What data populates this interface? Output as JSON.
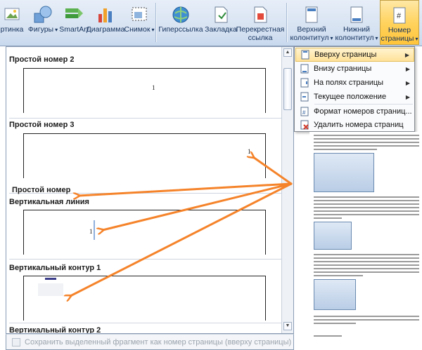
{
  "ribbon": {
    "buttons": [
      {
        "label": "Картинка",
        "icon": "picture-icon"
      },
      {
        "label": "Фигуры",
        "icon": "shapes-icon"
      },
      {
        "label": "SmartArt",
        "icon": "smartart-icon"
      },
      {
        "label": "Диаграмма",
        "icon": "chart-icon"
      },
      {
        "label": "Снимок",
        "icon": "screenshot-icon"
      },
      {
        "label": "Гиперссылка",
        "icon": "hyperlink-icon"
      },
      {
        "label": "Закладка",
        "icon": "bookmark-icon"
      },
      {
        "label": "Перекрестная ссылка",
        "line1": "Перекрестная",
        "line2": "ссылка",
        "icon": "cross-reference-icon"
      },
      {
        "label": "Верхний колонтитул",
        "line1": "Верхний",
        "line2": "колонтитул",
        "icon": "header-icon"
      },
      {
        "label": "Нижний колонтитул",
        "line1": "Нижний",
        "line2": "колонтитул",
        "icon": "footer-icon"
      },
      {
        "label": "Номер страницы",
        "line1": "Номер",
        "line2": "страницы",
        "icon": "page-number-icon"
      }
    ],
    "visible": {
      "picture": "ртинка",
      "shapes": "Фигуры",
      "smartart": "SmartArt",
      "chart": "Диаграмма",
      "screenshot": "Снимок",
      "hyperlink": "Гиперссылка",
      "bookmark": "Закладка",
      "crossref1": "Перекрестная",
      "crossref2": "ссылка",
      "header1": "Верхний",
      "header2": "колонтитул",
      "footer1": "Нижний",
      "footer2": "колонтитул",
      "pagenum1": "Номер",
      "pagenum2": "страницы"
    },
    "active_color": "#ffd35f"
  },
  "gallery": {
    "items": [
      {
        "title": "Простой номер 2",
        "number": "1"
      },
      {
        "title": "Простой номер 3",
        "number": "1"
      },
      {
        "title": "Вертикальная линия",
        "number": "1"
      },
      {
        "title": "Вертикальный контур 1",
        "number": ""
      },
      {
        "title": "Вертикальный контур 2",
        "number": ""
      }
    ],
    "annotation_label": "Простой номер",
    "footer_text": "Сохранить выделенный фрагмент как номер страницы (вверху страницы)"
  },
  "menu": {
    "items": [
      {
        "label": "Вверху страницы",
        "icon": "page-top-icon",
        "has_submenu": true,
        "highlighted": true
      },
      {
        "label": "Внизу страницы",
        "icon": "page-bottom-icon",
        "has_submenu": true
      },
      {
        "label": "На полях страницы",
        "icon": "page-margins-icon",
        "has_submenu": true
      },
      {
        "label": "Текущее положение",
        "icon": "current-position-icon",
        "has_submenu": true
      },
      {
        "label": "Формат номеров страниц...",
        "icon": "format-numbers-icon",
        "has_submenu": false
      },
      {
        "label": "Удалить номера страниц",
        "icon": "remove-numbers-icon",
        "has_submenu": false
      }
    ]
  },
  "annotation": {
    "arrow_color": "#f5832a"
  }
}
